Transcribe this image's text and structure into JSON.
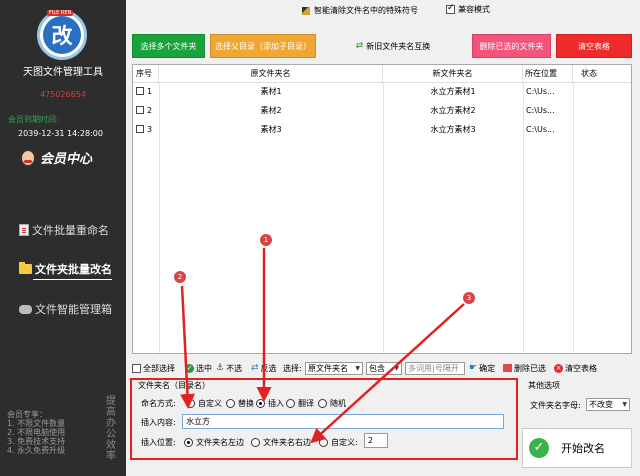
{
  "sidebar": {
    "logo_tag": "FILE REN",
    "logo_char": "改",
    "app_title": "天图文件管理工具",
    "qq": "475026654",
    "member_label": "会员到期时间:",
    "member_date": "2039-12-31 14:28:00",
    "member_center": "会员中心",
    "nav": [
      "文件批量重命名",
      "文件夹批量改名",
      "文件智能管理箱"
    ],
    "promo_lines": [
      "会员专享：",
      "1. 不限文件数量",
      "2. 不限电脑使用",
      "3. 免费技术支持",
      "4. 永久免费升级"
    ],
    "promo_side": "提高办公效率"
  },
  "topbar": {
    "title": "智能清除文件名中的特殊符号",
    "compat_label": "兼容模式"
  },
  "buttons": {
    "select_folders": "选择多个文件夹",
    "select_parent": "选择父目录（添加子目录）",
    "swap": "新旧文件夹名互换",
    "delete_selected": "删除已选的文件夹",
    "clear_table": "清空表格"
  },
  "table": {
    "headers": [
      "序号",
      "原文件夹名",
      "新文件夹名",
      "所在位置",
      "状态"
    ],
    "rows": [
      {
        "no": "1",
        "old": "素材1",
        "new": "水立方素材1",
        "loc": "C:\\Us..."
      },
      {
        "no": "2",
        "old": "素材2",
        "new": "水立方素材2",
        "loc": "C:\\Us..."
      },
      {
        "no": "3",
        "old": "素材3",
        "new": "水立方素材3",
        "loc": "C:\\Us..."
      }
    ]
  },
  "toolbar": {
    "select_all": "全部选择",
    "select": "选中",
    "deselect": "不选",
    "invert": "反选",
    "choose_label": "选择:",
    "choose_field": "原文件夹名",
    "match": "包含",
    "search_placeholder": "多词用|号隔开",
    "confirm": "确定",
    "delete_selected": "删除已选",
    "clear_table": "清空表格"
  },
  "form": {
    "section_title": "文件夹名（目录名）",
    "mode_label": "命名方式:",
    "modes": [
      "自定义",
      "替换",
      "插入",
      "翻译",
      "随机"
    ],
    "selected_mode": "插入",
    "content_label": "插入内容:",
    "content_value": "水立方",
    "position_label": "插入位置:",
    "positions": [
      "文件夹名左边",
      "文件夹名右边",
      "自定义:"
    ],
    "custom_value": "2"
  },
  "other": {
    "title": "其他选项",
    "case_label": "文件夹名字母:",
    "case_value": "不改变"
  },
  "start_label": "开始改名",
  "annotations": [
    "1",
    "2",
    "3"
  ],
  "colors": {
    "sidebar_bg": "#2d2d2d",
    "qq": "#e0383e",
    "member_label": "#2ea84a",
    "btn_green": "#1aa33a",
    "btn_orange": "#f0a632",
    "btn_pink": "#f2547c",
    "btn_red": "#ee2a2a",
    "highlight_red": "#e02222"
  }
}
